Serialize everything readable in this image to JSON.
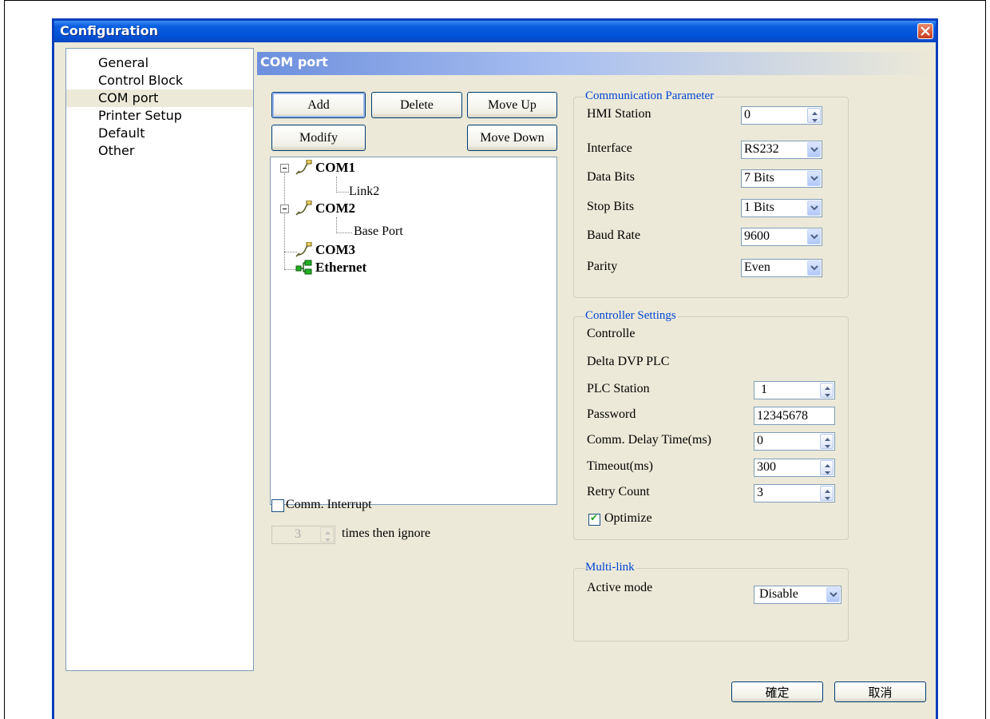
{
  "window": {
    "title": "Configuration"
  },
  "nav": {
    "items": [
      "General",
      "Control Block",
      "COM port",
      "Printer Setup",
      "Default",
      "Other"
    ],
    "selected_index": 2
  },
  "panel": {
    "header": "COM port"
  },
  "buttons": {
    "add": "Add",
    "delete": "Delete",
    "move_up": "Move Up",
    "modify": "Modify",
    "move_down": "Move Down"
  },
  "tree": {
    "com1": "COM1",
    "link2": "Link2",
    "com2": "COM2",
    "base_port": "Base Port",
    "com3": "COM3",
    "ethernet": "Ethernet"
  },
  "comm_interrupt": {
    "label": "Comm. Interrupt",
    "checked": false,
    "times_value": "3",
    "times_suffix": "times then ignore"
  },
  "communication_parameter": {
    "legend": "Communication Parameter",
    "hmi_station": {
      "label": "HMI Station",
      "value": "0"
    },
    "interface": {
      "label": "Interface",
      "value": "RS232"
    },
    "data_bits": {
      "label": "Data Bits",
      "value": "7 Bits"
    },
    "stop_bits": {
      "label": "Stop Bits",
      "value": "1 Bits"
    },
    "baud_rate": {
      "label": "Baud Rate",
      "value": "9600"
    },
    "parity": {
      "label": "Parity",
      "value": "Even"
    }
  },
  "controller_settings": {
    "legend": "Controller Settings",
    "controller_label": "Controlle",
    "controller_name": "Delta DVP PLC",
    "plc_station": {
      "label": "PLC Station",
      "value": "1"
    },
    "password": {
      "label": "Password",
      "value": "12345678"
    },
    "comm_delay": {
      "label": "Comm. Delay Time(ms)",
      "value": "0"
    },
    "timeout": {
      "label": "Timeout(ms)",
      "value": "300"
    },
    "retry_count": {
      "label": "Retry Count",
      "value": "3"
    },
    "optimize": {
      "label": "Optimize",
      "checked": true
    }
  },
  "multi_link": {
    "legend": "Multi-link",
    "active_mode": {
      "label": "Active mode",
      "value": "Disable"
    }
  },
  "footer": {
    "ok": "確定",
    "cancel": "取消"
  },
  "colors": {
    "title_bar": "#0052d6",
    "dialog_bg": "#ece9d8",
    "legend_text": "#0046d5",
    "close_button": "#c8391a"
  }
}
